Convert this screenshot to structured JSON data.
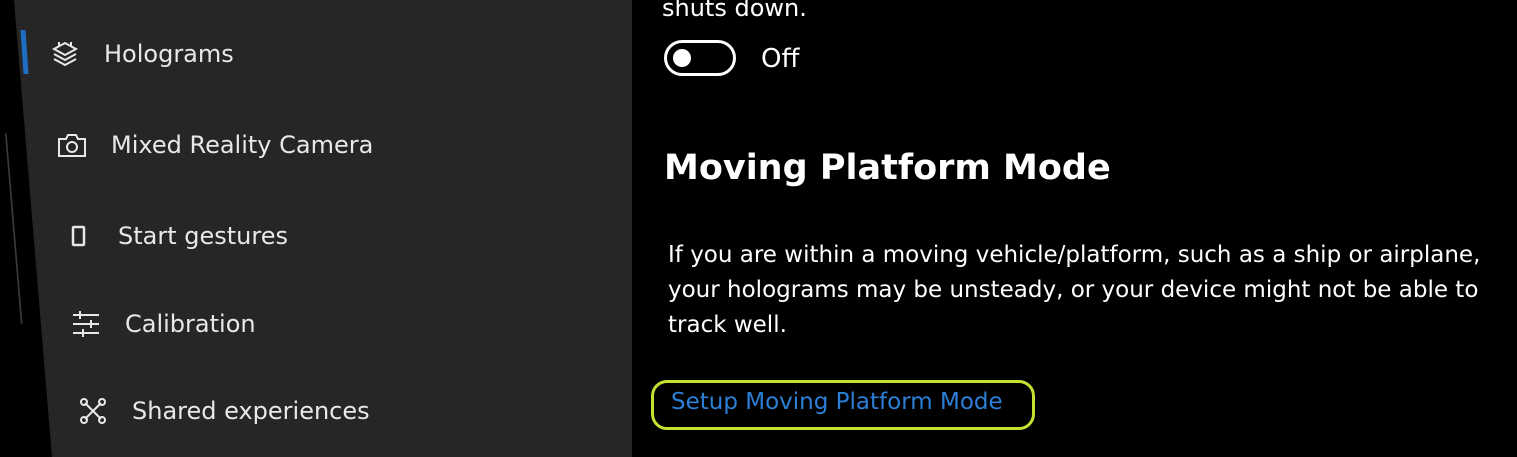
{
  "theme": {
    "accent": "#1e6fc4",
    "link": "#2c7fd6",
    "highlight": "#c4e030",
    "sidebar_bg": "#262626",
    "content_bg": "#000000"
  },
  "sidebar": {
    "items": [
      {
        "label": "Holograms",
        "icon": "holograms-icon",
        "active": true
      },
      {
        "label": "Mixed Reality Camera",
        "icon": "camera-icon",
        "active": false
      },
      {
        "label": "Start gestures",
        "icon": "start-gesture-icon",
        "active": false
      },
      {
        "label": "Calibration",
        "icon": "sliders-icon",
        "active": false
      },
      {
        "label": "Shared experiences",
        "icon": "shared-experiences-icon",
        "active": false
      }
    ]
  },
  "content": {
    "previous_text_tail": "shuts down.",
    "toggle": {
      "state": "off",
      "label": "Off"
    },
    "moving_platform": {
      "title": "Moving Platform Mode",
      "description": "If you are within a moving vehicle/platform, such as a ship or airplane, your holograms may be unsteady, or your device might not be able to track well.",
      "link": "Setup Moving Platform Mode"
    }
  }
}
